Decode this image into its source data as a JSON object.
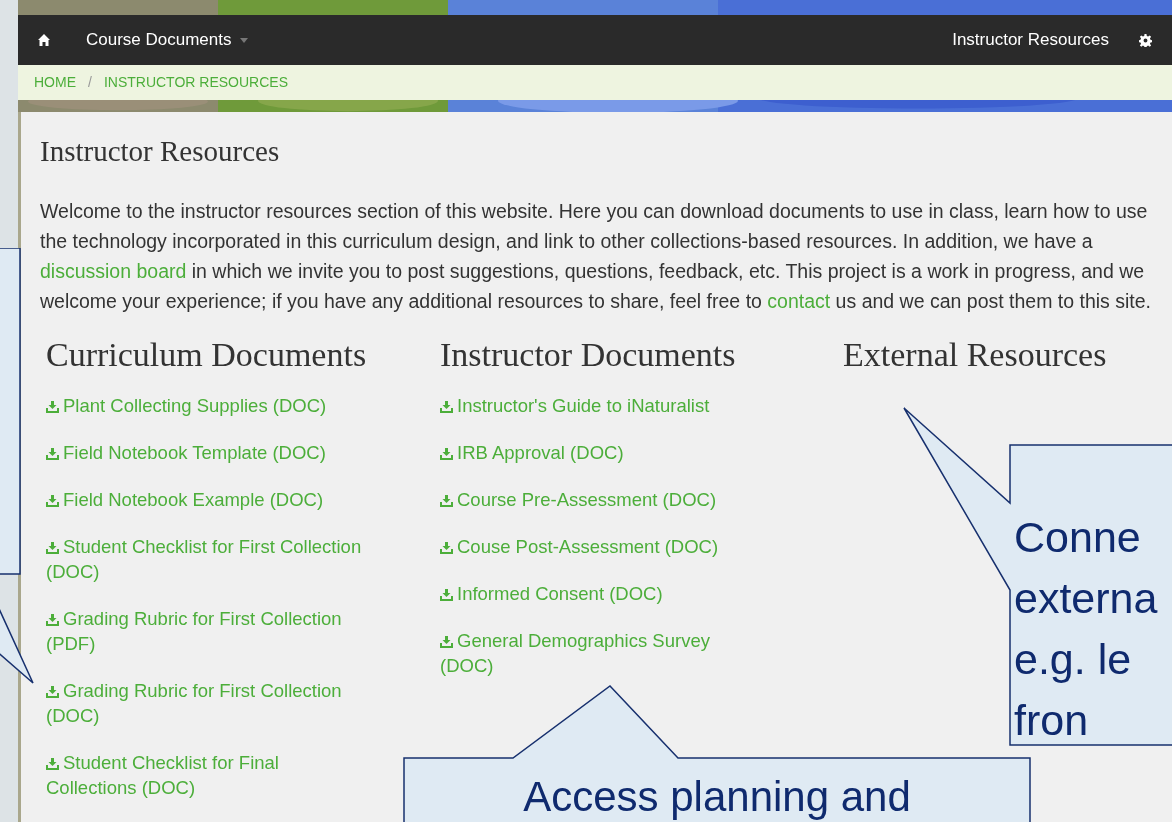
{
  "nav": {
    "menu": "Course Documents",
    "right_link": "Instructor Resources"
  },
  "breadcrumb": [
    "HOME",
    "/",
    "INSTRUCTOR RESOURCES"
  ],
  "title": "Instructor Resources",
  "intro": [
    {
      "kind": "text",
      "text": "Welcome to the instructor resources section of this website. Here you can download documents to use in class, learn how to use the technology incorporated in this curriculum design, and link to other collections-based resources. In addition, we have a "
    },
    {
      "kind": "link",
      "text": "discussion board"
    },
    {
      "kind": "text",
      "text": " in which we invite you to post suggestions, questions, feedback, etc. This project is a work in progress, and we welcome your experience; if you have any additional resources to share, feel free to "
    },
    {
      "kind": "link",
      "text": "contact"
    },
    {
      "kind": "text",
      "text": " us and we can post them to this site."
    }
  ],
  "columns": [
    {
      "heading": "Curriculum Documents",
      "items": [
        "Plant Collecting Supplies (DOC)",
        "Field Notebook Template (DOC)",
        "Field Notebook Example (DOC)",
        "Student Checklist for First Collection (DOC)",
        "Grading Rubric for First Collection (PDF)",
        "Grading Rubric for First Collection (DOC)",
        "Student Checklist for Final Collections (DOC)"
      ]
    },
    {
      "heading": "Instructor Documents",
      "items": [
        "Instructor's Guide to iNaturalist",
        "IRB Approval (DOC)",
        "Course Pre-Assessment (DOC)",
        "Couse Post-Assessment (DOC)",
        "Informed Consent (DOC)",
        "General Demographics Survey (DOC)"
      ]
    },
    {
      "heading": "External Resources"
    }
  ],
  "callouts": [
    {
      "lines": [
        "Conne",
        "externa",
        "e.g. le",
        "fron"
      ]
    },
    {
      "lines": [
        "Access planning and"
      ]
    }
  ]
}
